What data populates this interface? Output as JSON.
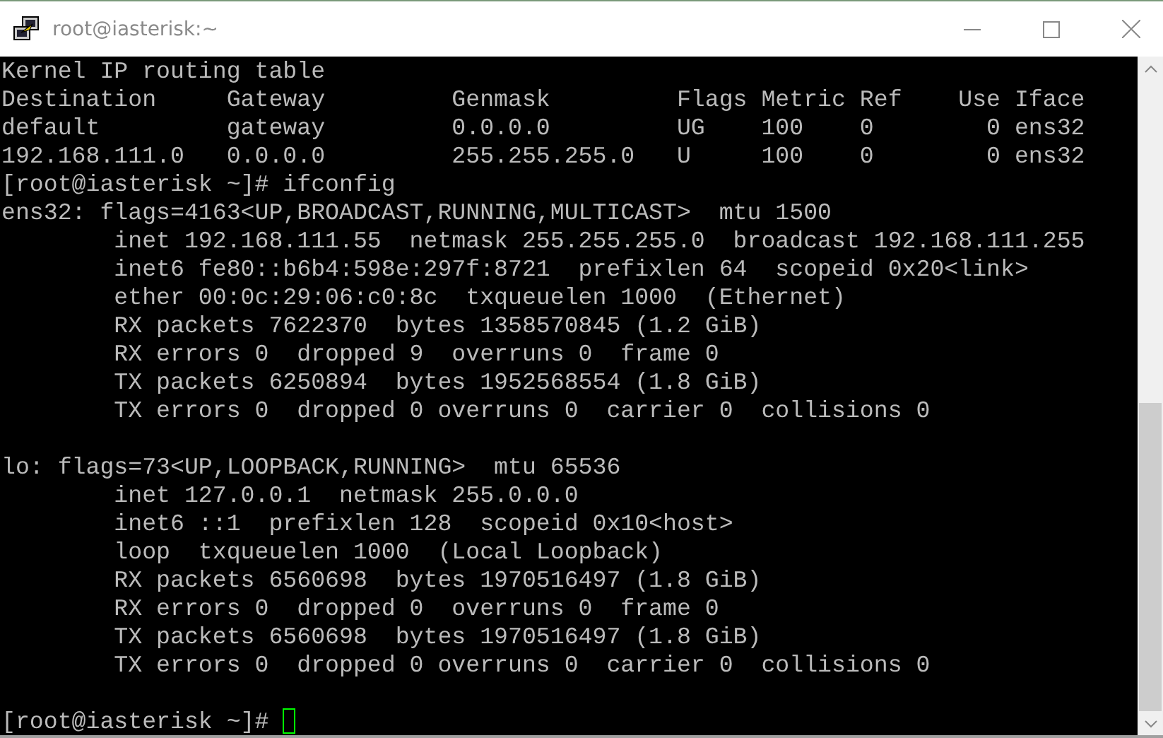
{
  "window": {
    "title": "root@iasterisk:~"
  },
  "terminal": {
    "lines": [
      {
        "kind": "output",
        "text": "Kernel IP routing table"
      },
      {
        "kind": "output",
        "text": "Destination     Gateway         Genmask         Flags Metric Ref    Use Iface"
      },
      {
        "kind": "output",
        "text": "default         gateway         0.0.0.0         UG    100    0        0 ens32"
      },
      {
        "kind": "output",
        "text": "192.168.111.0   0.0.0.0         255.255.255.0   U     100    0        0 ens32"
      },
      {
        "kind": "prompt",
        "prompt": "[root@iasterisk ~]#",
        "command": "ifconfig",
        "cursor": false
      },
      {
        "kind": "output",
        "text": "ens32: flags=4163<UP,BROADCAST,RUNNING,MULTICAST>  mtu 1500"
      },
      {
        "kind": "output",
        "text": "        inet 192.168.111.55  netmask 255.255.255.0  broadcast 192.168.111.255"
      },
      {
        "kind": "output",
        "text": "        inet6 fe80::b6b4:598e:297f:8721  prefixlen 64  scopeid 0x20<link>"
      },
      {
        "kind": "output",
        "text": "        ether 00:0c:29:06:c0:8c  txqueuelen 1000  (Ethernet)"
      },
      {
        "kind": "output",
        "text": "        RX packets 7622370  bytes 1358570845 (1.2 GiB)"
      },
      {
        "kind": "output",
        "text": "        RX errors 0  dropped 9  overruns 0  frame 0"
      },
      {
        "kind": "output",
        "text": "        TX packets 6250894  bytes 1952568554 (1.8 GiB)"
      },
      {
        "kind": "output",
        "text": "        TX errors 0  dropped 0 overruns 0  carrier 0  collisions 0"
      },
      {
        "kind": "blank"
      },
      {
        "kind": "output",
        "text": "lo: flags=73<UP,LOOPBACK,RUNNING>  mtu 65536"
      },
      {
        "kind": "output",
        "text": "        inet 127.0.0.1  netmask 255.0.0.0"
      },
      {
        "kind": "output",
        "text": "        inet6 ::1  prefixlen 128  scopeid 0x10<host>"
      },
      {
        "kind": "output",
        "text": "        loop  txqueuelen 1000  (Local Loopback)"
      },
      {
        "kind": "output",
        "text": "        RX packets 6560698  bytes 1970516497 (1.8 GiB)"
      },
      {
        "kind": "output",
        "text": "        RX errors 0  dropped 0  overruns 0  frame 0"
      },
      {
        "kind": "output",
        "text": "        TX packets 6560698  bytes 1970516497 (1.8 GiB)"
      },
      {
        "kind": "output",
        "text": "        TX errors 0  dropped 0 overruns 0  carrier 0  collisions 0"
      },
      {
        "kind": "blank"
      },
      {
        "kind": "prompt",
        "prompt": "[root@iasterisk ~]#",
        "cursor": true
      }
    ]
  }
}
